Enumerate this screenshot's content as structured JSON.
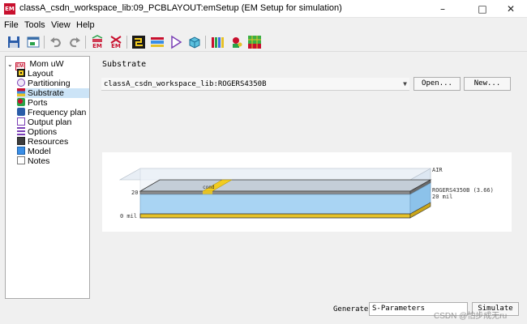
{
  "window": {
    "app_icon": "EM",
    "title": "classA_csdn_workspace_lib:09_PCBLAYOUT:emSetup (EM Setup for simulation)",
    "minimize": "–",
    "maximize": "□",
    "close": "✕"
  },
  "menu": {
    "items": [
      "File",
      "Tools",
      "View",
      "Help"
    ]
  },
  "toolbar": {
    "icons": [
      "save-icon",
      "open-icon",
      "undo-icon",
      "redo-icon",
      "em-icon",
      "em-stop-icon",
      "layout-icon",
      "substrate-icon",
      "simulate-icon",
      "3d-box-icon",
      "color-layers-icon",
      "ports-icon",
      "mesh-icon"
    ],
    "em_label": "EM",
    "em_stop_label": "EM"
  },
  "tree": {
    "root": "Mom uW",
    "root_badge": "EM",
    "items": [
      "Layout",
      "Partitioning",
      "Substrate",
      "Ports",
      "Frequency plan",
      "Output plan",
      "Options",
      "Resources",
      "Model",
      "Notes"
    ],
    "selected": "Substrate"
  },
  "substrate": {
    "section_title": "Substrate",
    "selected_file": "classA_csdn_workspace_lib:ROGERS4350B",
    "open_button": "Open...",
    "new_button": "New...",
    "stack": {
      "air_label": "AIR",
      "dielectric_label": "ROGERS4350B (3.66)",
      "thickness_label": "20 mil",
      "conductor_label": "cond",
      "left_top_label": "20",
      "left_bottom_label": "0 mil",
      "colors": {
        "air": "#dde7f2",
        "dielectric": "#a9d4f3",
        "metal_layer": "#7a7a7a",
        "ground": "#e6c229",
        "conductor": "#f2cc1f"
      }
    }
  },
  "footer": {
    "generate_label": "Generate:",
    "generate_value": "S-Parameters",
    "simulate_button": "Simulate",
    "watermark": "CSDN @怕步成无ru"
  }
}
